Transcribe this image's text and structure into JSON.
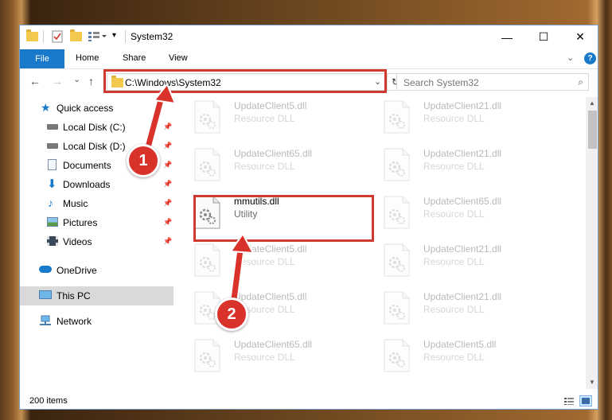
{
  "window": {
    "title": "System32",
    "controls": {
      "minimize": "—",
      "maximize": "☐",
      "close": "✕"
    }
  },
  "ribbon": {
    "tabs": [
      {
        "label": "File"
      },
      {
        "label": "Home"
      },
      {
        "label": "Share"
      },
      {
        "label": "View"
      }
    ],
    "help": "?"
  },
  "navigation": {
    "back": "←",
    "forward": "→",
    "recent": "⌄",
    "up": "↑",
    "address": "C:\\Windows\\System32",
    "address_dropdown": "⌄",
    "refresh": "↻",
    "search_placeholder": "Search System32"
  },
  "sidebar": {
    "items": [
      {
        "label": "Quick access",
        "icon": "star-icon"
      },
      {
        "label": "Local Disk (C:)",
        "icon": "drive-icon",
        "pinned": true
      },
      {
        "label": "Local Disk (D:)",
        "icon": "drive-icon",
        "pinned": true
      },
      {
        "label": "Documents",
        "icon": "documents-icon",
        "pinned": true
      },
      {
        "label": "Downloads",
        "icon": "downloads-icon",
        "pinned": true
      },
      {
        "label": "Music",
        "icon": "music-icon",
        "pinned": true
      },
      {
        "label": "Pictures",
        "icon": "pictures-icon",
        "pinned": true
      },
      {
        "label": "Videos",
        "icon": "videos-icon",
        "pinned": true
      },
      {
        "label": "OneDrive",
        "icon": "cloud-icon"
      },
      {
        "label": "This PC",
        "icon": "computer-icon",
        "selected": true
      },
      {
        "label": "Network",
        "icon": "network-icon"
      }
    ]
  },
  "files": {
    "left": [
      {
        "name": "UpdateClient5.dll",
        "type": "Resource DLL",
        "faded": true
      },
      {
        "name": "UpdateClient65.dll",
        "type": "Resource DLL",
        "faded": true
      },
      {
        "name": "mmutils.dll",
        "type": "Utility",
        "faded": false
      },
      {
        "name": "UpdateClient5.dll",
        "type": "Resource DLL",
        "faded": true
      },
      {
        "name": "UpdateClient5.dll",
        "type": "Resource DLL",
        "faded": true
      },
      {
        "name": "UpdateClient65.dll",
        "type": "Resource DLL",
        "faded": true
      }
    ],
    "right": [
      {
        "name": "UpdateClient21.dll",
        "type": "Resource DLL",
        "faded": true
      },
      {
        "name": "UpdateClient21.dll",
        "type": "Resource DLL",
        "faded": true
      },
      {
        "name": "UpdateClient65.dll",
        "type": "Resource DLL",
        "faded": true
      },
      {
        "name": "UpdateClient21.dll",
        "type": "Resource DLL",
        "faded": true
      },
      {
        "name": "UpdateClient21.dll",
        "type": "Resource DLL",
        "faded": true
      },
      {
        "name": "UpdateClient5.dll",
        "type": "Resource DLL",
        "faded": true
      }
    ]
  },
  "status": {
    "item_count": "200 items"
  },
  "annotations": {
    "step1": "1",
    "step2": "2",
    "highlight_color": "#d0392f"
  },
  "colors": {
    "accent": "#1979ca",
    "selection": "#d9d9d9"
  }
}
